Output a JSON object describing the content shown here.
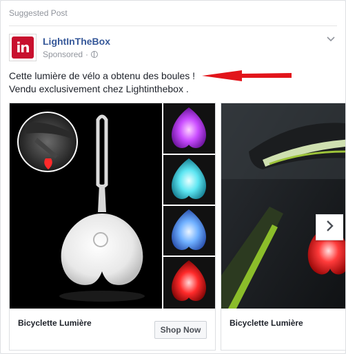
{
  "post": {
    "label": "Suggested Post",
    "page_name": "LightInTheBox",
    "avatar_text": "in",
    "sponsored": "Sponsored",
    "separator": "·",
    "text_line1": "Cette lumière de vélo a obtenu des boules !",
    "text_line2": "Vendu exclusivement chez Lightinthebox ."
  },
  "carousel": {
    "cards": [
      {
        "title": "Bicyclette Lumière",
        "button": "Shop Now"
      },
      {
        "title": "Bicyclette Lumière"
      }
    ]
  },
  "icons": {
    "menu": "chevron-down-icon",
    "privacy": "globe-icon",
    "next": "chevron-right-icon",
    "annotation": "red-arrow"
  },
  "colors": {
    "page_name": "#365899",
    "brand": "#c8102e",
    "annotation_arrow": "#e2151b"
  }
}
